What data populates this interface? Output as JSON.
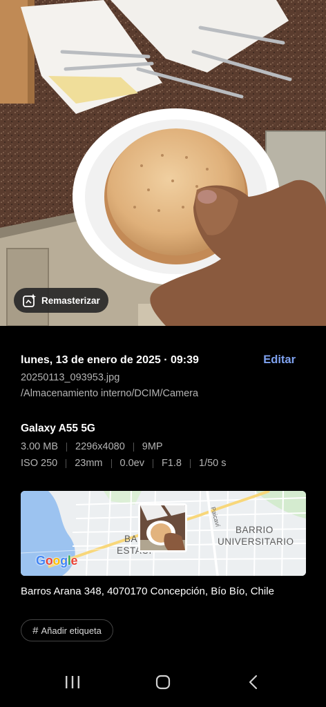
{
  "photo": {
    "remaster_label": "Remasterizar",
    "remaster_icon": "sparkle-image-icon"
  },
  "details": {
    "date_time": "lunes, 13 de enero de 2025 · 09:39",
    "edit_label": "Editar",
    "filename": "20250113_093953.jpg",
    "path": "/Almacenamiento interno/DCIM/Camera",
    "device": "Galaxy A55 5G",
    "specs_row1": [
      "3.00 MB",
      "2296x4080",
      "9MP"
    ],
    "specs_row2": [
      "ISO 250",
      "23mm",
      "0.0ev",
      "F1.8",
      "1/50 s"
    ]
  },
  "map": {
    "label_barrio_universitario_1": "BARRIO",
    "label_barrio_universitario_2": "UNIVERSITARIO",
    "label_barrio_estacion_1": "BA",
    "label_barrio_estacion_2": "ESTACI",
    "street_label": "Paicaví",
    "logo_text": "Google",
    "logo_colors": [
      "#4285F4",
      "#EA4335",
      "#FBBC05",
      "#4285F4",
      "#34A853",
      "#EA4335"
    ]
  },
  "address": "Barros Arana 348, 4070170 Concepción, Bío Bío, Chile",
  "tag_button": {
    "icon": "#",
    "label": "Añadir etiqueta"
  },
  "navbar": {
    "recent_icon": "recent-apps-icon",
    "home_icon": "home-icon",
    "back_icon": "back-icon"
  },
  "colors": {
    "accent": "#7fa2f0",
    "secondary_text": "#b4b4b4",
    "background": "#000000"
  }
}
